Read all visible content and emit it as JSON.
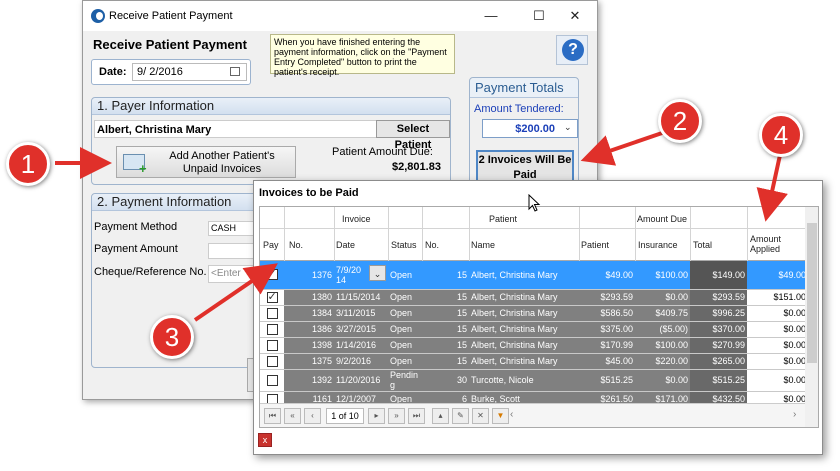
{
  "window": {
    "title": "Receive Patient Payment",
    "minimize": "—",
    "maximize": "☐",
    "close": "✕",
    "heading": "Receive Patient Payment",
    "hint": "When you have finished entering the payment information, click on the \"Payment Entry Completed\" button to print the patient's receipt.",
    "help_label": "?"
  },
  "date": {
    "label": "Date:",
    "value": "9/  2/2016"
  },
  "payer": {
    "section": "1. Payer Information",
    "name": "Albert, Christina Mary",
    "select_button": "Select Patient",
    "add_button": "Add Another Patient's Unpaid Invoices",
    "amount_due_label": "Patient Amount Due:",
    "amount_due_value": "$2,801.83"
  },
  "payment": {
    "section": "2. Payment Information",
    "method_label": "Payment Method",
    "method_value": "CASH",
    "amount_label": "Payment Amount",
    "cheque_label": "Cheque/Reference No.",
    "cheque_placeholder": "<Enter"
  },
  "totals": {
    "title": "Payment Totals",
    "tendered_label": "Amount Tendered:",
    "tendered_value": "$200.00",
    "invoices_button": "2 Invoices Will Be Paid"
  },
  "invoices": {
    "title": "Invoices to be Paid",
    "group_headers": {
      "invoice": "Invoice",
      "patient": "Patient",
      "amount_due": "Amount Due"
    },
    "columns": {
      "pay": "Pay",
      "no": "No.",
      "date": "Date",
      "status": "Status",
      "pno": "No.",
      "name": "Name",
      "patient": "Patient",
      "insurance": "Insurance",
      "total": "Total",
      "applied": "Amount Applied"
    },
    "rows": [
      {
        "checked": true,
        "no": "1376",
        "date": "7/9/2014",
        "status": "Open",
        "pno": "15",
        "name": "Albert, Christina Mary",
        "patient": "$49.00",
        "insurance": "$100.00",
        "total": "$149.00",
        "applied": "$49.00",
        "selected": true
      },
      {
        "checked": true,
        "no": "1380",
        "date": "11/15/2014",
        "status": "Open",
        "pno": "15",
        "name": "Albert, Christina Mary",
        "patient": "$293.59",
        "insurance": "$0.00",
        "total": "$293.59",
        "applied": "$151.00"
      },
      {
        "checked": false,
        "no": "1384",
        "date": "3/11/2015",
        "status": "Open",
        "pno": "15",
        "name": "Albert, Christina Mary",
        "patient": "$586.50",
        "insurance": "$409.75",
        "total": "$996.25",
        "applied": "$0.00"
      },
      {
        "checked": false,
        "no": "1386",
        "date": "3/27/2015",
        "status": "Open",
        "pno": "15",
        "name": "Albert, Christina Mary",
        "patient": "$375.00",
        "insurance": "($5.00)",
        "total": "$370.00",
        "applied": "$0.00"
      },
      {
        "checked": false,
        "no": "1398",
        "date": "1/14/2016",
        "status": "Open",
        "pno": "15",
        "name": "Albert, Christina Mary",
        "patient": "$170.99",
        "insurance": "$100.00",
        "total": "$270.99",
        "applied": "$0.00"
      },
      {
        "checked": false,
        "no": "1375",
        "date": "9/2/2016",
        "status": "Open",
        "pno": "15",
        "name": "Albert, Christina Mary",
        "patient": "$45.00",
        "insurance": "$220.00",
        "total": "$265.00",
        "applied": "$0.00"
      },
      {
        "checked": false,
        "no": "1392",
        "date": "11/20/2016",
        "status": "Pending",
        "pno": "30",
        "name": "Turcotte, Nicole",
        "patient": "$515.25",
        "insurance": "$0.00",
        "total": "$515.25",
        "applied": "$0.00"
      },
      {
        "checked": false,
        "no": "1161",
        "date": "12/1/2007",
        "status": "Open",
        "pno": "6",
        "name": "Burke, Scott",
        "patient": "$261.50",
        "insurance": "$171.00",
        "total": "$432.50",
        "applied": "$0.00"
      }
    ],
    "pager": "1 of 10",
    "close": "x"
  },
  "callouts": [
    "1",
    "2",
    "3",
    "4"
  ],
  "colors": {
    "callout": "#e0302a",
    "selected_row": "#3399ff",
    "link_blue": "#1b3fb8"
  }
}
